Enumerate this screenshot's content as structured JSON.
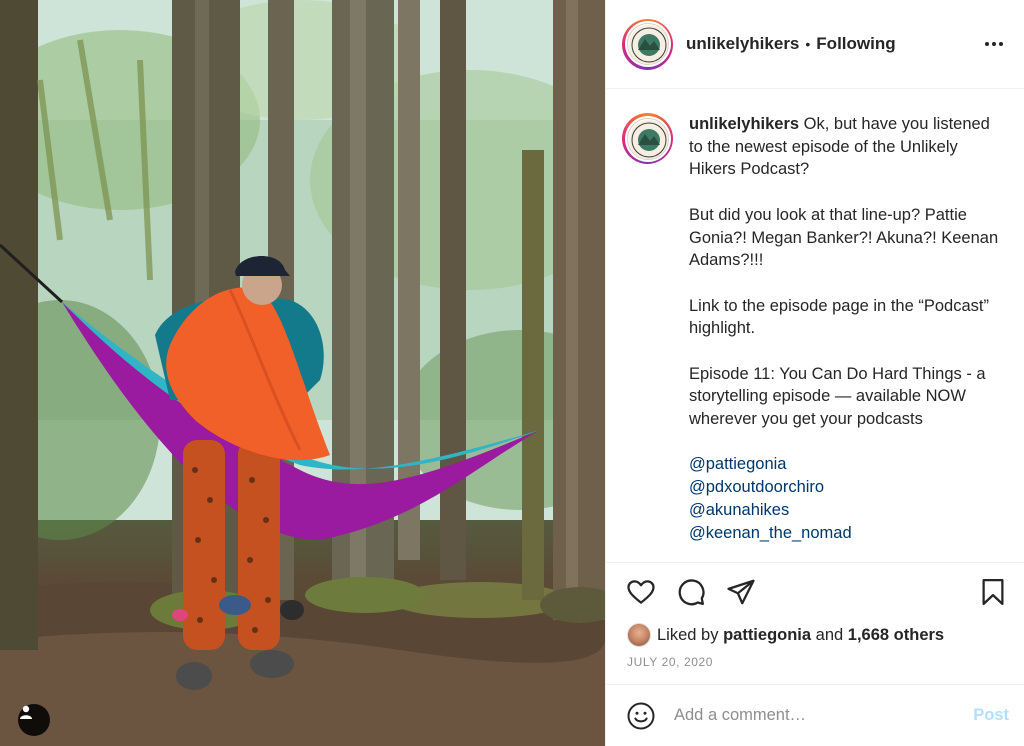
{
  "post": {
    "username": "unlikelyhikers",
    "separator": "•",
    "follow_status": "Following",
    "avatar_badge_text": "UNLIKELY HIKERS",
    "caption": {
      "username": "unlikelyhikers",
      "line1": "Ok, but have you listened to the newest episode of the Unlikely Hikers Podcast?",
      "line2": "But did you look at that line-up? Pattie Gonia?! Megan Banker?! Akuna?! Keenan Adams?!!!",
      "line3": "Link to the episode page in the “Podcast” highlight.",
      "line4": "Episode 11: You Can Do Hard Things - a storytelling episode — available NOW wherever you get your podcasts",
      "mentions": [
        "@pattiegonia",
        "@pdxoutdoorchiro",
        "@akunahikes",
        "@keenan_the_nomad"
      ]
    },
    "likes": {
      "prefix": "Liked by",
      "liker": "pattiegonia",
      "conjunction": "and",
      "others": "1,668 others"
    },
    "date": "JULY 20, 2020",
    "comment": {
      "placeholder": "Add a comment…",
      "post_label": "Post"
    }
  },
  "icons": {
    "like": "heart-icon",
    "comment": "comment-icon",
    "share": "send-icon",
    "save": "bookmark-icon",
    "more": "more-icon",
    "emoji": "emoji-icon",
    "tag": "user-tag-icon"
  },
  "colors": {
    "text": "#262626",
    "muted": "#8e8e8e",
    "link": "#00376b",
    "post_disabled": "#b2dffc",
    "hammock_purple": "#9a1aa0",
    "hammock_teal": "#2fb5c6",
    "sleeping_bag": "#f2602a"
  }
}
